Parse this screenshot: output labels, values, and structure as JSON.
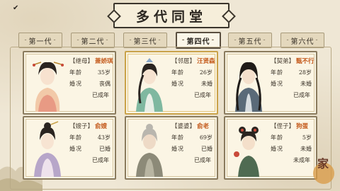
{
  "title": "多代同堂",
  "tabs": [
    {
      "label": "第一代",
      "active": false
    },
    {
      "label": "第二代",
      "active": false
    },
    {
      "label": "第三代",
      "active": false
    },
    {
      "label": "第四代",
      "active": true
    },
    {
      "label": "第五代",
      "active": false
    },
    {
      "label": "第六代",
      "active": false
    }
  ],
  "labels": {
    "age": "年龄",
    "marriage": "婚况"
  },
  "cards": [
    {
      "role": "【继母】",
      "name": "萧娇琪",
      "age": "35岁",
      "marriage": "丧偶",
      "status": "已成年",
      "selected": false
    },
    {
      "role": "【邻居】",
      "name": "汪贤森",
      "age": "26岁",
      "marriage": "未婚",
      "status": "已成年",
      "selected": true
    },
    {
      "role": "【契弟】",
      "name": "甄不行",
      "age": "28岁",
      "marriage": "未婚",
      "status": "已成年",
      "selected": false
    },
    {
      "role": "【嫂子】",
      "name": "俞嫂",
      "age": "43岁",
      "marriage": "已婚",
      "status": "已成年",
      "selected": false
    },
    {
      "role": "【婆婆】",
      "name": "俞老",
      "age": "69岁",
      "marriage": "已婚",
      "status": "已成年",
      "selected": false
    },
    {
      "role": "【侄子】",
      "name": "狗蛋",
      "age": "5岁",
      "marriage": "未婚",
      "status": "未成年",
      "selected": false
    }
  ],
  "stamp": "家"
}
